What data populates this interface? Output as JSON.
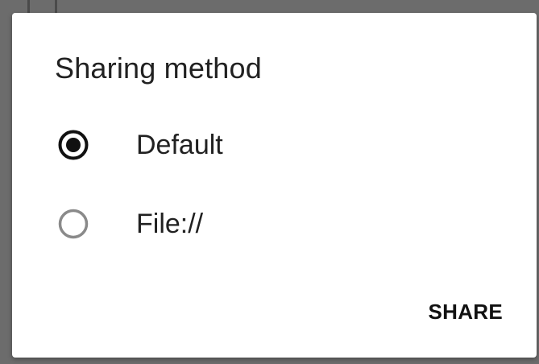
{
  "dialog": {
    "title": "Sharing method",
    "options": [
      {
        "label": "Default",
        "selected": true
      },
      {
        "label": "File://",
        "selected": false
      }
    ],
    "share_label": "SHARE"
  },
  "colors": {
    "radio_selected": "#111111",
    "radio_unselected": "#8a8a8a",
    "text": "#212121",
    "dialog_bg": "#ffffff",
    "scrim": "#6c6c6c"
  }
}
